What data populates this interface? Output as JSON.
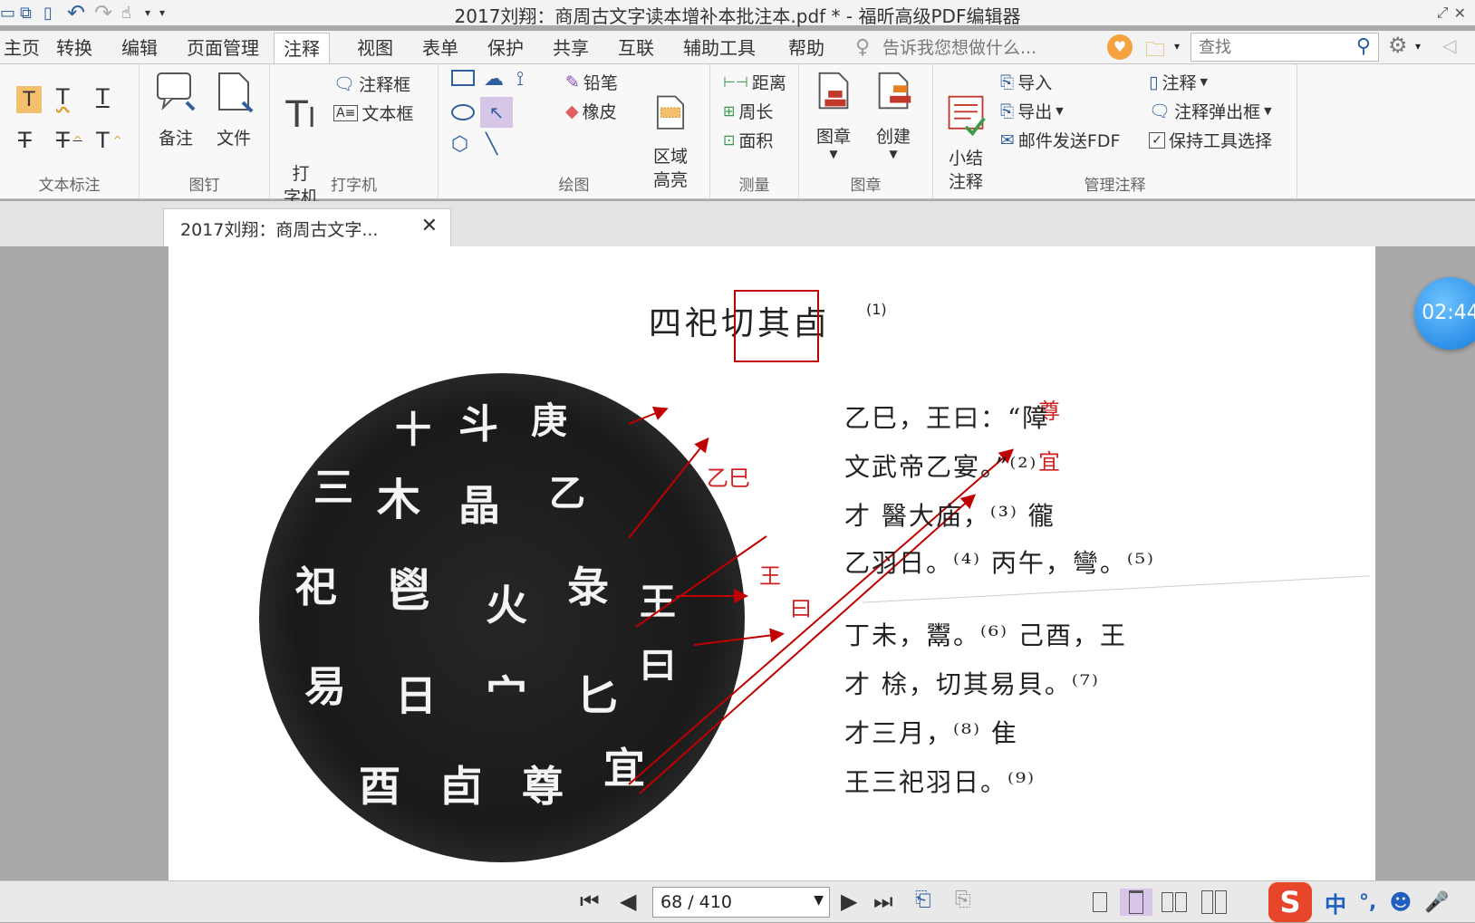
{
  "window": {
    "title": "2017刘翔：商周古文字读本增补本批注本.pdf * - 福昕高级PDF编辑器"
  },
  "menu": {
    "tabs": [
      "主页",
      "转换",
      "编辑",
      "页面管理",
      "注释",
      "视图",
      "表单",
      "保护",
      "共享",
      "互联",
      "辅助工具",
      "帮助"
    ],
    "active_tab": "注释",
    "tell_me": "告诉我您想做什么...",
    "search_placeholder": "查找"
  },
  "ribbon": {
    "groups": {
      "text_markup": "文本标注",
      "pin": "图钉",
      "typewriter": "打字机",
      "drawing": "绘图",
      "measure": "测量",
      "stamp": "图章",
      "manage": "管理注释"
    },
    "pin": {
      "note": "备注",
      "file": "文件"
    },
    "typewriter": {
      "big": "打\n字机",
      "callout": "注释框",
      "textbox": "文本框"
    },
    "drawing": {
      "pencil": "铅笔",
      "eraser": "橡皮",
      "area_highlight": "区域\n高亮"
    },
    "measure": {
      "distance": "距离",
      "perimeter": "周长",
      "area": "面积"
    },
    "stamp": {
      "stamp": "图章",
      "create": "创建"
    },
    "manage": {
      "summary": "小结\n注释",
      "import": "导入",
      "export": "导出",
      "email": "邮件发送FDF",
      "comment": "注释",
      "popup": "注释弹出框",
      "keep_tool": "保持工具选择"
    }
  },
  "doc_tab": {
    "label": "2017刘翔：商周古文字..."
  },
  "document": {
    "title_chars": [
      "四",
      "祀",
      "切",
      "其",
      "卣"
    ],
    "title_note": "(1)",
    "lines": [
      "乙巳，王曰：“障",
      "文武帝乙宴。”⁽²⁾",
      "才 醫大庙，⁽³⁾ 徿",
      "乙羽日。⁽⁴⁾ 丙午，彎。⁽⁵⁾",
      "丁未，鬻。⁽⁶⁾ 己酉，王",
      "才 梌，切其易貝。⁽⁷⁾",
      "才三月，⁽⁸⁾ 隹",
      "王三祀羽日。⁽⁹⁾"
    ],
    "annotations": [
      "尊",
      "宜",
      "乙巳",
      "王",
      "曰"
    ]
  },
  "timer": "02:44",
  "pager": {
    "current": "68",
    "total": "410",
    "display": "68 / 410"
  },
  "ime": {
    "mode": "中"
  },
  "colors": {
    "accent_red": "#c00000",
    "timer_blue": "#2e90e8"
  }
}
